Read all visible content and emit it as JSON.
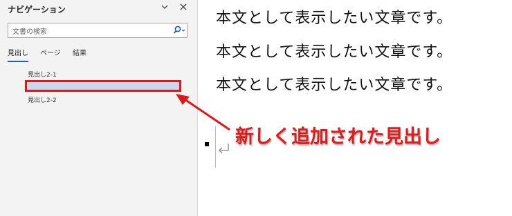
{
  "nav": {
    "title": "ナビゲーション",
    "search_placeholder": "文書の検索",
    "tabs": [
      "見出し",
      "ページ",
      "結果"
    ],
    "active_tab": "見出し",
    "headings": [
      "見出し2-1",
      "",
      "見出し2-2"
    ]
  },
  "document": {
    "lines": [
      "本文として表示したい文章です。",
      "本文として表示したい文章です。",
      "本文として表示したい文章です。"
    ]
  },
  "annotation": {
    "text": "新しく追加された見出し",
    "color": "#e11b1b"
  },
  "colors": {
    "highlight_fill": "#c8d8ee",
    "highlight_border": "#dd1818",
    "active_tab_underline": "#1f5fb0"
  },
  "icons": {
    "collapse": "chevron-down-icon",
    "close": "close-icon",
    "search": "search-icon",
    "paragraph_return": "return-arrow-icon"
  }
}
